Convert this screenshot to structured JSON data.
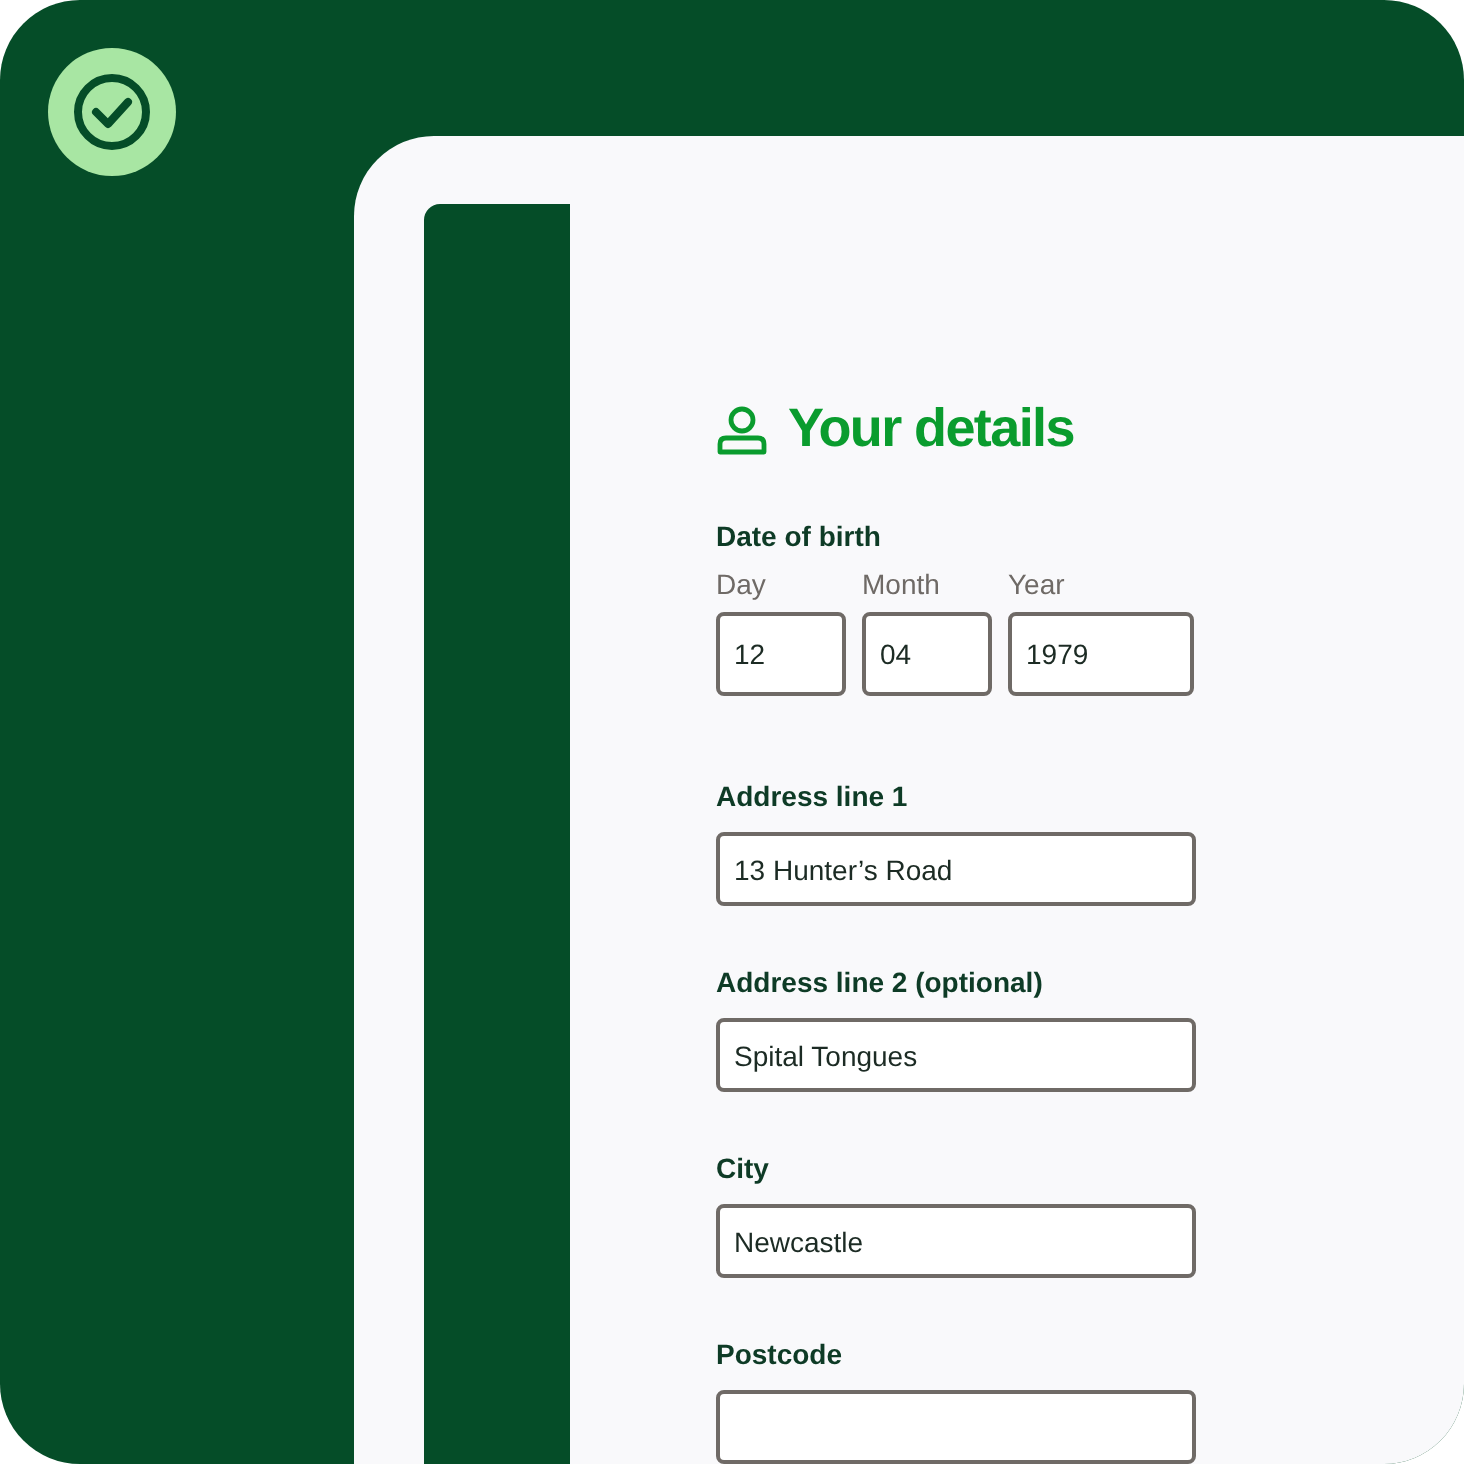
{
  "heading": "Your details",
  "date_of_birth": {
    "label": "Date of birth",
    "parts": [
      {
        "label": "Day",
        "value": "12"
      },
      {
        "label": "Month",
        "value": "04"
      },
      {
        "label": "Year",
        "value": "1979"
      }
    ]
  },
  "fields": [
    {
      "label": "Address line 1",
      "value": "13 Hunter’s Road"
    },
    {
      "label": "Address line 2 (optional)",
      "value": "Spital Tongues"
    },
    {
      "label": "City",
      "value": "Newcastle"
    },
    {
      "label": "Postcode"
    }
  ]
}
